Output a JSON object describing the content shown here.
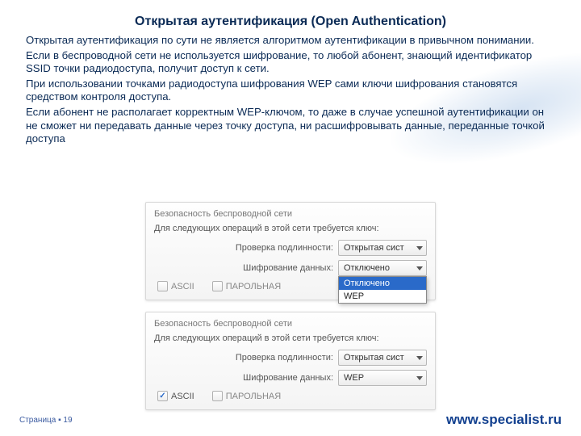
{
  "heading": "Открытая аутентификация (Open Authentication)",
  "paragraphs": [
    "Открытая аутентификация по сути не является алгоритмом аутентификации в привычном понимании.",
    "Если в беспроводной сети не используется шифрование, то любой абонент, знающий идентификатор SSID точки радиодоступа, получит доступ к сети.",
    "При использовании точками радиодоступа шифрования WEP сами ключи шифрования становятся средством контроля доступа.",
    "Если абонент не располагает корректным WEP-ключом, то даже в случае успешной аутентификации он не сможет ни передавать данные через точку доступа, ни расшифровывать данные, переданные точкой доступа"
  ],
  "panel1": {
    "title": "Безопасность беспроводной сети",
    "subtitle": "Для следующих операций в этой сети требуется ключ:",
    "auth_label": "Проверка подлинности:",
    "auth_value": "Открытая сист",
    "encrypt_label": "Шифрование данных:",
    "encrypt_value": "Отключено",
    "dropdown_options_selected": "Отключено",
    "dropdown_options_other": "WEP",
    "ascii_label": "ASCII",
    "pass_label": "ПАРОЛЬНАЯ"
  },
  "panel2": {
    "title": "Безопасность беспроводной сети",
    "subtitle": "Для следующих операций в этой сети требуется ключ:",
    "auth_label": "Проверка подлинности:",
    "auth_value": "Открытая сист",
    "encrypt_label": "Шифрование данных:",
    "encrypt_value": "WEP",
    "ascii_label": "ASCII",
    "pass_label": "ПАРОЛЬНАЯ"
  },
  "footer": {
    "page_label": "Страница ▪ 19",
    "url": "www.specialist.ru"
  }
}
